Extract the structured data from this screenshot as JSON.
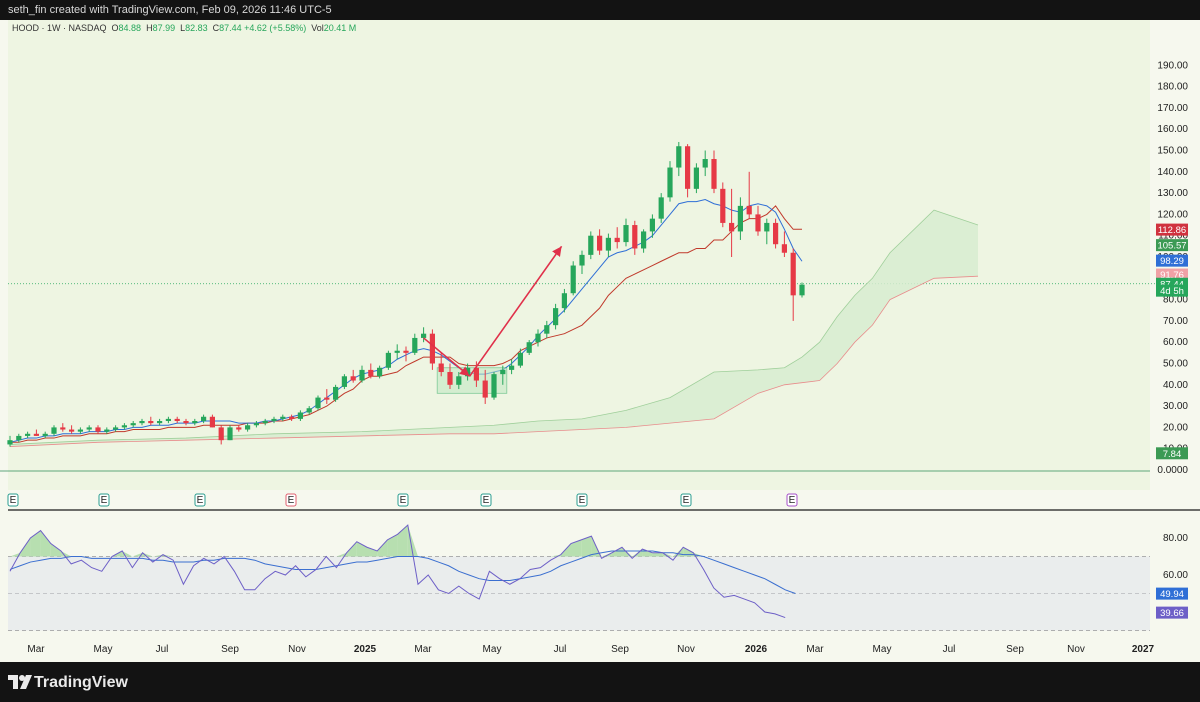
{
  "header": {
    "created_by": "seth_fin created with TradingView.com, Feb 09, 2026 11:46 UTC-5"
  },
  "legend": {
    "symbol": "HOOD · 1W · NASDAQ",
    "o_label": "O",
    "o_value": "84.88",
    "h_label": "H",
    "h_value": "87.99",
    "l_label": "L",
    "l_value": "82.83",
    "c_label": "C",
    "c_value": "87.44 +4.62 (+5.58%)",
    "vol_label": "Vol",
    "vol_value": "20.41 M"
  },
  "brand": {
    "name": "TradingView"
  },
  "colors": {
    "up": "#26a65b",
    "down": "#e63946",
    "kijun": "#c0392b",
    "tenkan": "#2f6fd6",
    "cloud": "#d7ecd0",
    "rsi_line": "#6d5fc7",
    "rsi_ma": "#3b6fd0",
    "annotation": "#e0304a"
  },
  "chart_data": [
    {
      "type": "candlestick",
      "ylabels": [
        "190.00",
        "180.00",
        "170.00",
        "160.00",
        "150.00",
        "140.00",
        "130.00",
        "120.00",
        "110.00",
        "100.00",
        "90.00",
        "80.00",
        "70.00",
        "60.00",
        "50.00",
        "40.00",
        "30.00",
        "20.00",
        "10.00",
        "0.0000"
      ],
      "yticks": [
        190,
        180,
        170,
        160,
        150,
        140,
        130,
        120,
        110,
        100,
        90,
        80,
        70,
        60,
        50,
        40,
        30,
        20,
        10,
        0
      ],
      "xlabels": [
        "Mar",
        "May",
        "Jul",
        "Sep",
        "Nov",
        "2025",
        "Mar",
        "May",
        "Jul",
        "Sep",
        "Nov",
        "2026",
        "Mar",
        "May",
        "Jul",
        "Sep",
        "Nov",
        "2027"
      ],
      "price_tags": [
        {
          "label": "112.86",
          "value": 112.86,
          "color": "#d0323f"
        },
        {
          "label": "105.57",
          "value": 105.57,
          "color": "#3c9a54"
        },
        {
          "label": "98.29",
          "value": 98.29,
          "color": "#2f6fd6"
        },
        {
          "label": "91.76",
          "value": 91.76,
          "color": "#f0a1a6"
        },
        {
          "label": "87.44",
          "value": 87.44,
          "color": "#26a65b"
        },
        {
          "label": "4d 5h",
          "value": 84.2,
          "color": "#26a65b"
        },
        {
          "label": "7.84",
          "value": 7.84,
          "color": "#3c9a54"
        }
      ],
      "candles": [
        [
          12,
          16,
          11,
          14
        ],
        [
          14,
          17,
          13,
          16
        ],
        [
          16,
          18,
          15,
          17
        ],
        [
          17,
          19,
          16,
          16
        ],
        [
          16,
          18,
          15,
          17
        ],
        [
          17,
          21,
          16,
          20
        ],
        [
          20,
          22,
          18,
          19
        ],
        [
          19,
          21,
          17,
          18
        ],
        [
          18,
          20,
          17,
          19
        ],
        [
          19,
          21,
          18,
          20
        ],
        [
          20,
          21,
          17,
          18
        ],
        [
          18,
          20,
          17,
          19
        ],
        [
          19,
          21,
          18,
          20
        ],
        [
          20,
          22,
          19,
          21
        ],
        [
          21,
          23,
          20,
          22
        ],
        [
          22,
          24,
          21,
          23
        ],
        [
          23,
          25,
          21,
          22
        ],
        [
          22,
          24,
          21,
          23
        ],
        [
          23,
          25,
          22,
          24
        ],
        [
          24,
          25,
          22,
          23
        ],
        [
          23,
          24,
          21,
          22
        ],
        [
          22,
          24,
          21,
          23
        ],
        [
          23,
          26,
          22,
          25
        ],
        [
          25,
          26,
          20,
          20
        ],
        [
          20,
          21,
          12,
          14
        ],
        [
          14,
          21,
          14,
          20
        ],
        [
          20,
          21,
          18,
          19
        ],
        [
          19,
          22,
          18,
          21
        ],
        [
          21,
          23,
          20,
          22
        ],
        [
          22,
          24,
          21,
          23
        ],
        [
          23,
          25,
          22,
          24
        ],
        [
          24,
          26,
          23,
          25
        ],
        [
          25,
          26,
          23,
          24
        ],
        [
          24,
          28,
          23,
          27
        ],
        [
          27,
          30,
          26,
          29
        ],
        [
          29,
          35,
          28,
          34
        ],
        [
          34,
          38,
          31,
          33
        ],
        [
          33,
          40,
          32,
          39
        ],
        [
          39,
          45,
          38,
          44
        ],
        [
          44,
          47,
          41,
          42
        ],
        [
          42,
          49,
          41,
          47
        ],
        [
          47,
          50,
          43,
          44
        ],
        [
          44,
          49,
          43,
          48
        ],
        [
          48,
          56,
          47,
          55
        ],
        [
          55,
          59,
          52,
          56
        ],
        [
          56,
          58,
          51,
          55
        ],
        [
          55,
          64,
          54,
          62
        ],
        [
          62,
          67,
          60,
          64
        ],
        [
          64,
          66,
          47,
          50
        ],
        [
          50,
          55,
          44,
          46
        ],
        [
          46,
          50,
          38,
          40
        ],
        [
          40,
          46,
          38,
          44
        ],
        [
          44,
          50,
          42,
          48
        ],
        [
          48,
          51,
          39,
          42
        ],
        [
          42,
          47,
          31,
          34
        ],
        [
          34,
          46,
          33,
          45
        ],
        [
          45,
          49,
          40,
          47
        ],
        [
          47,
          52,
          45,
          49
        ],
        [
          49,
          57,
          48,
          55
        ],
        [
          55,
          61,
          54,
          60
        ],
        [
          60,
          66,
          58,
          64
        ],
        [
          64,
          70,
          62,
          68
        ],
        [
          68,
          78,
          66,
          76
        ],
        [
          76,
          85,
          74,
          83
        ],
        [
          83,
          98,
          82,
          96
        ],
        [
          96,
          103,
          92,
          101
        ],
        [
          101,
          112,
          99,
          110
        ],
        [
          110,
          113,
          101,
          103
        ],
        [
          103,
          111,
          100,
          109
        ],
        [
          109,
          114,
          104,
          107
        ],
        [
          107,
          118,
          105,
          115
        ],
        [
          115,
          117,
          101,
          104
        ],
        [
          104,
          113,
          102,
          112
        ],
        [
          112,
          120,
          109,
          118
        ],
        [
          118,
          130,
          116,
          128
        ],
        [
          128,
          145,
          126,
          142
        ],
        [
          142,
          154,
          138,
          152
        ],
        [
          152,
          153,
          128,
          132
        ],
        [
          132,
          144,
          130,
          142
        ],
        [
          142,
          150,
          138,
          146
        ],
        [
          146,
          150,
          130,
          132
        ],
        [
          132,
          135,
          114,
          116
        ],
        [
          116,
          132,
          100,
          112
        ],
        [
          112,
          128,
          108,
          124
        ],
        [
          124,
          140,
          118,
          120
        ],
        [
          120,
          124,
          110,
          112
        ],
        [
          112,
          118,
          106,
          116
        ],
        [
          116,
          118,
          104,
          106
        ],
        [
          106,
          112,
          100,
          102
        ],
        [
          102,
          104,
          70,
          82
        ],
        [
          82,
          88,
          81,
          87
        ]
      ],
      "kijun": [
        13,
        13,
        14,
        14,
        15,
        15,
        16,
        16,
        16,
        17,
        17,
        17,
        18,
        18,
        19,
        19,
        19,
        19,
        20,
        20,
        20,
        20,
        21,
        21,
        21,
        21,
        21,
        22,
        22,
        22,
        23,
        23,
        24,
        25,
        26,
        28,
        30,
        33,
        36,
        38,
        42,
        44,
        44,
        45,
        46,
        49,
        51,
        53,
        53,
        53,
        53,
        50,
        49,
        49,
        49,
        49,
        50,
        52,
        56,
        58,
        60,
        62,
        63,
        64,
        66,
        68,
        72,
        76,
        82,
        86,
        90,
        92,
        94,
        96,
        98,
        100,
        102,
        102,
        104,
        104,
        108,
        108,
        112,
        116,
        118,
        118,
        120,
        124,
        118,
        113,
        113
      ],
      "tenkan": [
        13,
        14,
        15,
        15,
        16,
        16,
        17,
        17,
        17,
        18,
        18,
        18,
        19,
        19,
        20,
        20,
        21,
        21,
        21,
        22,
        22,
        22,
        23,
        23,
        23,
        23,
        22,
        22,
        22,
        23,
        23,
        24,
        25,
        26,
        28,
        31,
        34,
        37,
        40,
        43,
        45,
        46,
        47,
        49,
        52,
        54,
        56,
        57,
        56,
        54,
        51,
        48,
        46,
        45,
        45,
        46,
        47,
        50,
        54,
        58,
        63,
        67,
        71,
        75,
        80,
        85,
        90,
        95,
        100,
        102,
        103,
        105,
        107,
        110,
        115,
        120,
        125,
        126,
        126,
        127,
        125,
        124,
        122,
        121,
        124,
        125,
        124,
        121,
        113,
        104,
        98
      ],
      "cloud_top_x": [
        0,
        10,
        20,
        30,
        40,
        50,
        55,
        60,
        65,
        70,
        75,
        80,
        85,
        88,
        90,
        92,
        94,
        96,
        98,
        100,
        105,
        110
      ],
      "cloud_top": [
        12,
        14,
        15,
        17,
        18,
        20,
        21,
        23,
        24,
        28,
        34,
        46,
        47,
        48,
        53,
        60,
        72,
        82,
        90,
        102,
        122,
        115
      ],
      "cloud_bot_x": [
        0,
        10,
        20,
        30,
        40,
        50,
        55,
        60,
        65,
        70,
        75,
        80,
        85,
        88,
        90,
        92,
        94,
        96,
        98,
        100,
        105,
        110
      ],
      "cloud_bot": [
        11,
        13,
        14,
        15,
        16,
        17,
        17,
        18,
        19,
        20,
        22,
        24,
        36,
        40,
        41,
        42,
        50,
        60,
        68,
        80,
        90,
        91
      ]
    },
    {
      "type": "line",
      "name": "RSI",
      "ylabels": [
        "80.00",
        "60.00"
      ],
      "yticks": [
        80,
        60
      ],
      "levels": [
        70,
        50,
        30
      ],
      "price_tags": [
        {
          "label": "49.94",
          "value": 49.94,
          "color": "#2f6fd6"
        },
        {
          "label": "39.66",
          "value": 39.66,
          "color": "#6d5fc7"
        }
      ],
      "rsi": [
        62,
        72,
        80,
        84,
        77,
        73,
        66,
        68,
        64,
        62,
        70,
        73,
        64,
        72,
        67,
        71,
        68,
        55,
        65,
        69,
        66,
        70,
        62,
        52,
        52,
        58,
        62,
        60,
        65,
        59,
        63,
        70,
        64,
        72,
        78,
        75,
        73,
        79,
        82,
        87,
        55,
        60,
        52,
        50,
        54,
        50,
        47,
        62,
        58,
        55,
        58,
        63,
        64,
        68,
        71,
        77,
        79,
        81,
        69,
        72,
        75,
        69,
        74,
        72,
        72,
        68,
        75,
        72,
        63,
        53,
        48,
        49,
        47,
        45,
        40,
        39,
        37
      ],
      "rsi_ma": [
        63,
        65,
        67,
        68,
        69,
        69,
        70,
        70,
        69,
        69,
        69,
        69,
        69,
        69,
        68,
        68,
        67,
        67,
        67,
        68,
        68,
        69,
        69,
        69,
        68,
        66,
        65,
        64,
        63,
        63,
        63,
        64,
        65,
        66,
        67,
        67,
        68,
        69,
        70,
        70,
        70,
        69,
        67,
        65,
        62,
        60,
        58,
        57,
        57,
        57,
        58,
        59,
        60,
        62,
        65,
        67,
        69,
        71,
        72,
        73,
        73,
        73,
        73,
        73,
        72,
        72,
        71,
        71,
        70,
        68,
        66,
        64,
        62,
        60,
        58,
        55,
        52,
        50
      ]
    }
  ]
}
